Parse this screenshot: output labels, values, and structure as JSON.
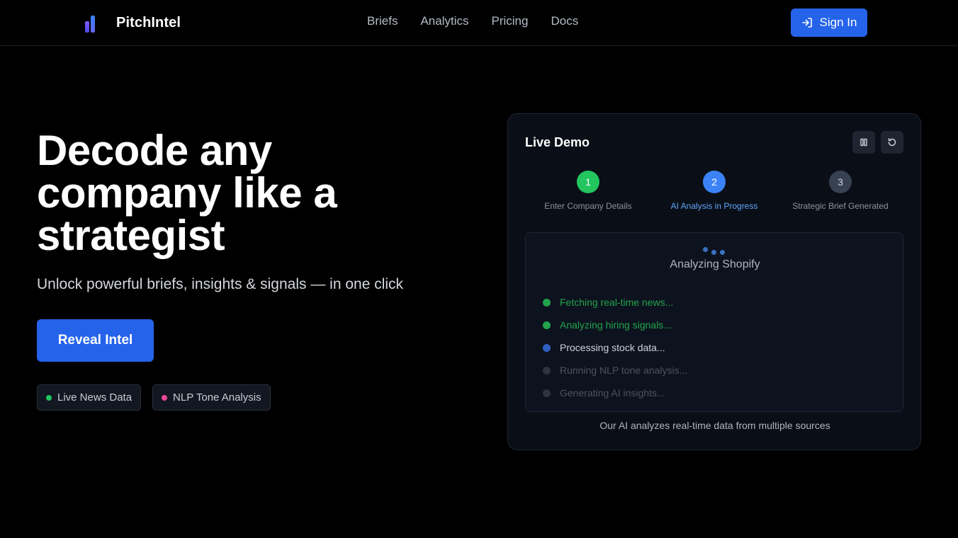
{
  "nav": {
    "brand": "PitchIntel",
    "links": [
      "Briefs",
      "Analytics",
      "Pricing",
      "Docs"
    ],
    "signin_label": "Sign In"
  },
  "hero": {
    "title_line1": "Decode any",
    "title_line2": "company like a",
    "title_line3": "strategist",
    "subtitle": "Unlock powerful briefs, insights & signals — in one click",
    "cta_label": "Reveal Intel",
    "badges": [
      {
        "label": "Live News Data",
        "color": "#22c55e"
      },
      {
        "label": "NLP Tone Analysis",
        "color": "#ec4899"
      }
    ]
  },
  "demo": {
    "title": "Live Demo",
    "controls": {
      "pause_icon": "pause-icon",
      "restart_icon": "restart-icon"
    },
    "steps": [
      {
        "number": "1",
        "label": "Enter Company Details",
        "state": "done"
      },
      {
        "number": "2",
        "label": "AI Analysis in Progress",
        "state": "active"
      },
      {
        "number": "3",
        "label": "Strategic Brief Generated",
        "state": "pending"
      }
    ],
    "analysis_title": "Analyzing Shopify",
    "tasks": [
      {
        "label": "Fetching real-time news...",
        "state": "done"
      },
      {
        "label": "Analyzing hiring signals...",
        "state": "done"
      },
      {
        "label": "Processing stock data...",
        "state": "active"
      },
      {
        "label": "Running NLP tone analysis...",
        "state": "pending"
      },
      {
        "label": "Generating AI insights...",
        "state": "pending"
      }
    ],
    "footer": "Our AI analyzes real-time data from multiple sources"
  },
  "colors": {
    "accent": "#2563eb",
    "success": "#22c55e",
    "background": "#000000"
  }
}
